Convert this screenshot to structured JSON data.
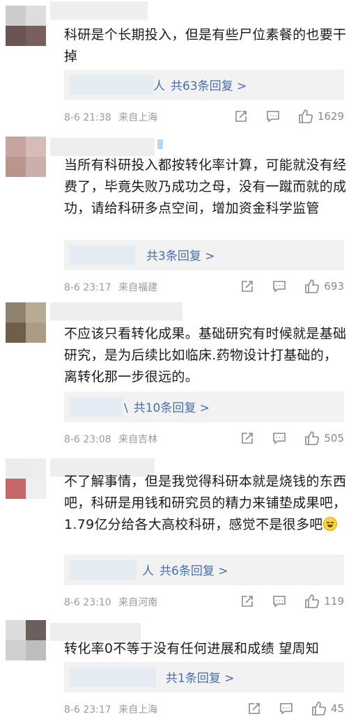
{
  "comments": [
    {
      "text": "科研是个长期投入，但是有些尸位素餐的也要干掉",
      "reply_prefix": "人",
      "reply_text": "共63条回复 >",
      "time": "8-6 21:38",
      "location": "来自上海",
      "likes": "1629",
      "avatar_colors": [
        "#cccccc",
        "#dddddd",
        "#6b5552",
        "#7a5e5b"
      ]
    },
    {
      "text": "当所有科研投入都按转化率计算，可能就没有经费了，毕竟失败乃成功之母，没有一蹴而就的成功，请给科研多点空间，增加资金科学监管",
      "reply_prefix": "",
      "reply_text": "共3条回复 >",
      "time": "8-6 23:17",
      "location": "来自福建",
      "likes": "693",
      "avatar_colors": [
        "#c7a49f",
        "#d6bcb8",
        "#b99590",
        "#cab0ac"
      ]
    },
    {
      "text": "不应该只看转化成果。基础研究有时候就是基础研究，是为后续比如临床.药物设计打基础的，离转化那一步很远的。",
      "reply_prefix": "\\",
      "reply_text": "共10条回复 >",
      "time": "8-6 23:08",
      "location": "来自吉林",
      "likes": "505",
      "avatar_colors": [
        "#8e836e",
        "#b7ab95",
        "#705f48",
        "#ab9c83"
      ]
    },
    {
      "text": "不了解事情，但是我觉得科研本就是烧钱的东西吧，科研是用钱和研究员的精力来铺垫成果吧，1.79亿分给各大高校科研，感觉不是很多吧",
      "reply_prefix": "人",
      "reply_text": "共6条回复 >",
      "time": "8-6 23:10",
      "location": "来自河南",
      "likes": "119",
      "avatar_colors": [
        "#ececec",
        "#ededed",
        "#c4666a",
        "#efefef"
      ]
    },
    {
      "text": "转化率0不等于没有任何进展和成绩 望周知",
      "reply_prefix": "",
      "reply_text": "共1条回复 >",
      "time": "8-6 23:17",
      "location": "来自上海",
      "likes": "45",
      "avatar_colors": [
        "#dcdcdc",
        "#6e5f5f",
        "#cfcfcf",
        "#bdbdbd"
      ]
    }
  ]
}
